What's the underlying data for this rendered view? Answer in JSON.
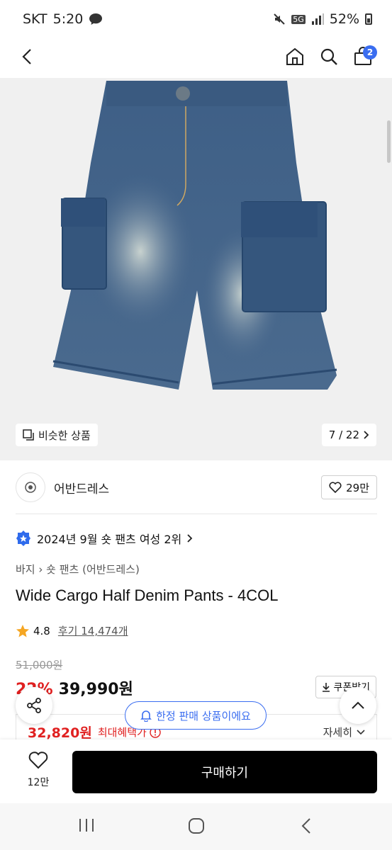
{
  "status": {
    "carrier": "SKT",
    "time": "5:20",
    "network": "5G",
    "battery": "52%"
  },
  "nav": {
    "cart_count": "2"
  },
  "hero": {
    "similar_label": "비슷한 상품",
    "pager": "7 / 22"
  },
  "brand": {
    "name": "어반드레스",
    "likes": "29만"
  },
  "rank": {
    "text": "2024년 9월 숏 팬츠 여성 2위"
  },
  "breadcrumb": {
    "category": "바지",
    "subcategory": "숏 팬츠 (어반드레스)"
  },
  "product": {
    "title": "Wide Cargo Half Denim Pants - 4COL",
    "rating": "4.8",
    "reviews": "후기 14,474개",
    "original_price": "51,000원",
    "discount": "22%",
    "price": "39,990원",
    "coupon_label": "쿠폰받기"
  },
  "benefit": {
    "price": "32,820원",
    "label": "최대혜택가",
    "more": "자세히"
  },
  "toast": {
    "text": "한정 판매 상품이에요"
  },
  "bottom": {
    "wish_count": "12만",
    "buy_label": "구매하기"
  },
  "colors": {
    "accent": "#3a6df0",
    "sale": "#e02020",
    "buy_bg": "#000000"
  }
}
